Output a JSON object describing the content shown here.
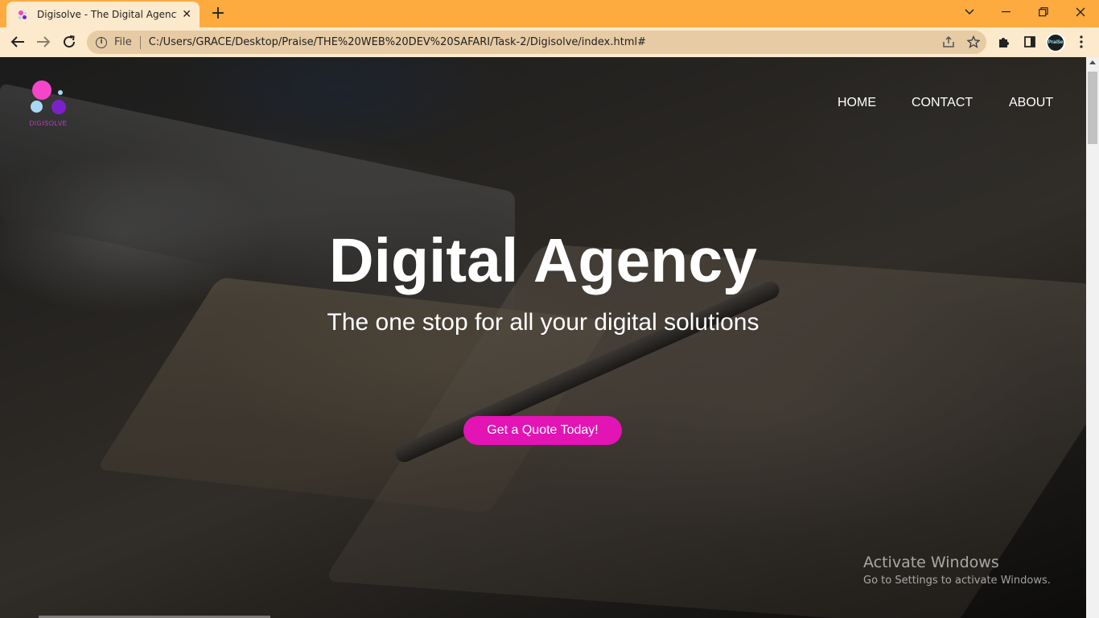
{
  "browser": {
    "tab": {
      "title": "Digisolve - The Digital Agency for",
      "close_glyph": "✕",
      "favicon": "digisolve-favicon"
    },
    "new_tab_glyph": "+",
    "window_controls": {
      "tab_search": "⌄",
      "minimize": "—",
      "restore": "❐",
      "close": "✕"
    },
    "address_bar": {
      "info_glyph": "i",
      "scheme_label": "File",
      "url": "C:/Users/GRACE/Desktop/Praise/THE%20WEB%20DEV%20SAFARI/Task-2/Digisolve/index.html#"
    },
    "profile_text": "PraiSe"
  },
  "page": {
    "logo": {
      "text": "DIGISOLVE",
      "colors": [
        "#f545c8",
        "#a9d8f5",
        "#7a22c8",
        "#a9d8f5"
      ]
    },
    "nav": {
      "home": "HOME",
      "contact": "CONTACT",
      "about": "ABOUT"
    },
    "hero": {
      "title": "Digital Agency",
      "subtitle": "The one stop for all your digital solutions",
      "cta_label": "Get a Quote Today!"
    },
    "watermark": {
      "line1": "Activate Windows",
      "line2": "Go to Settings to activate Windows."
    }
  },
  "colors": {
    "tabbar": "#fdab3f",
    "toolbar": "#fde9cb",
    "accent": "#e214b4"
  }
}
